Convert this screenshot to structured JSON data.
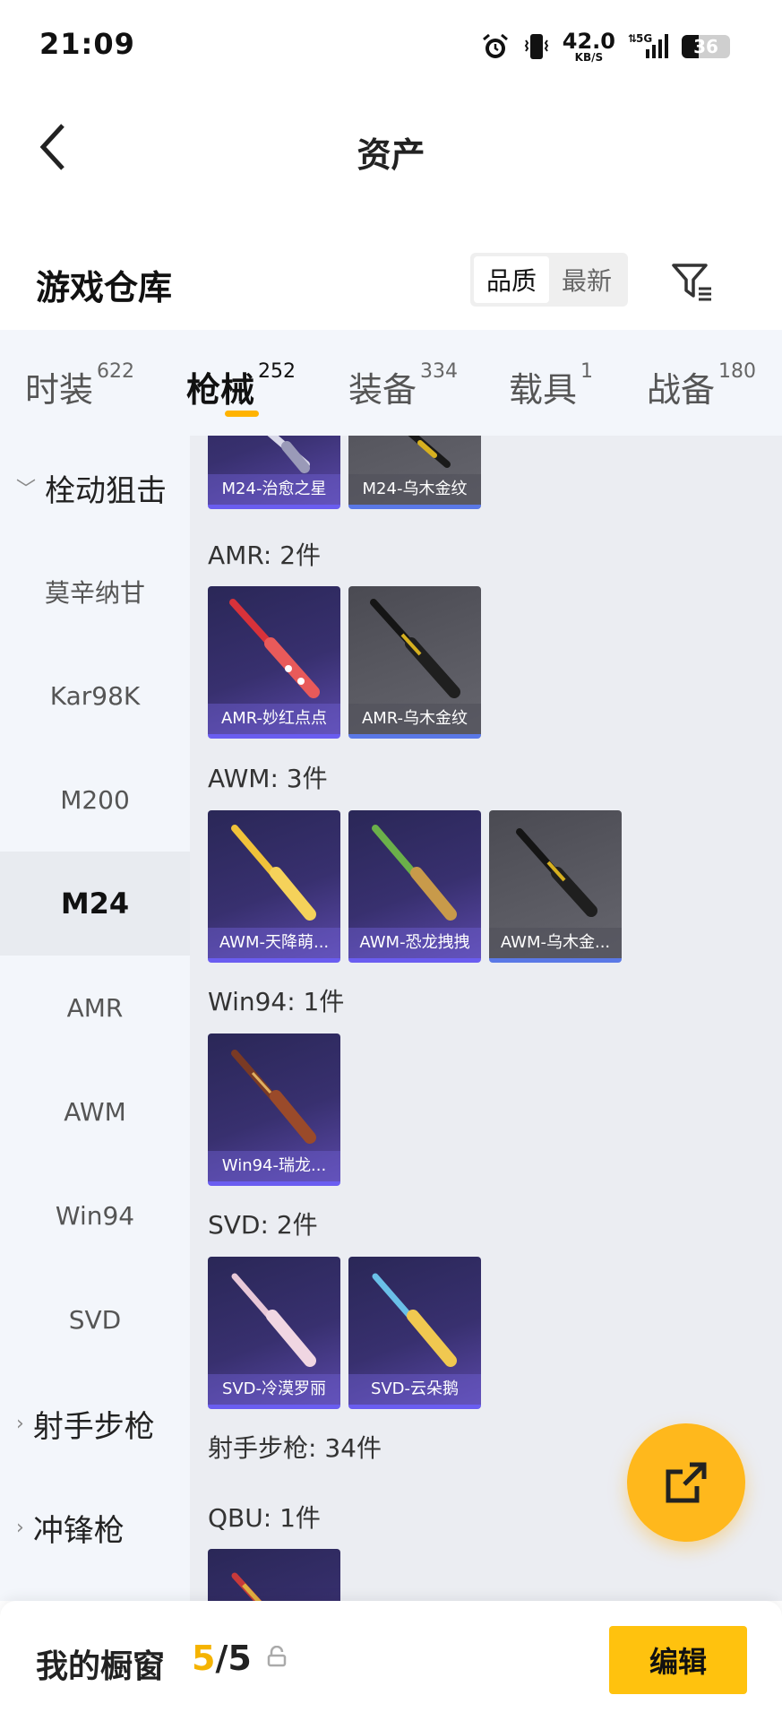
{
  "status_bar": {
    "time": "21:09",
    "speed_value": "42.0",
    "speed_unit": "KB/S",
    "network": "5G",
    "battery": "36",
    "icons": [
      "alarm-icon",
      "vibrate-icon",
      "signal-icon",
      "battery-icon"
    ]
  },
  "nav": {
    "title": "资产",
    "back_icon": "back-arrow-icon"
  },
  "header": {
    "title": "游戏仓库",
    "sort_options": [
      "品质",
      "最新"
    ],
    "sort_selected": "品质",
    "filter_icon": "filter-icon"
  },
  "categories": [
    {
      "label": "时装",
      "count": "622"
    },
    {
      "label": "枪械",
      "count": "252",
      "active": true
    },
    {
      "label": "装备",
      "count": "334"
    },
    {
      "label": "载具",
      "count": "1"
    },
    {
      "label": "战备",
      "count": "180"
    }
  ],
  "sidebar": {
    "group_bolt": "栓动狙击",
    "items": [
      "莫辛纳甘",
      "Kar98K",
      "M200",
      "M24",
      "AMR",
      "AWM",
      "Win94",
      "SVD"
    ],
    "active_item": "M24",
    "group_dmr": "射手步枪",
    "group_smg": "冲锋枪"
  },
  "content": {
    "top_cards": [
      "M24-治愈之星",
      "M24-乌木金纹"
    ],
    "sections": [
      {
        "title": "AMR: 2件",
        "cards": [
          "AMR-妙红点点",
          "AMR-乌木金纹"
        ]
      },
      {
        "title": "AWM: 3件",
        "cards": [
          "AWM-天降萌...",
          "AWM-恐龙拽拽",
          "AWM-乌木金..."
        ]
      },
      {
        "title": "Win94: 1件",
        "cards": [
          "Win94-瑞龙..."
        ]
      },
      {
        "title": "SVD: 2件",
        "cards": [
          "SVD-冷漠罗丽",
          "SVD-云朵鹅"
        ]
      }
    ],
    "dmr_title": "射手步枪: 34件",
    "qbu_title": "QBU: 1件"
  },
  "fab": {
    "icon": "share-icon"
  },
  "bottom": {
    "label": "我的橱窗",
    "current": "5",
    "separator": "/",
    "total": "5",
    "lock_icon": "lock-icon",
    "edit_label": "编辑"
  },
  "colors": {
    "accent": "#ffb300",
    "edit_button": "#ffc20e",
    "fab": "#ffb81c",
    "card_purple": "#38306f",
    "card_grey": "#5b5b63"
  }
}
